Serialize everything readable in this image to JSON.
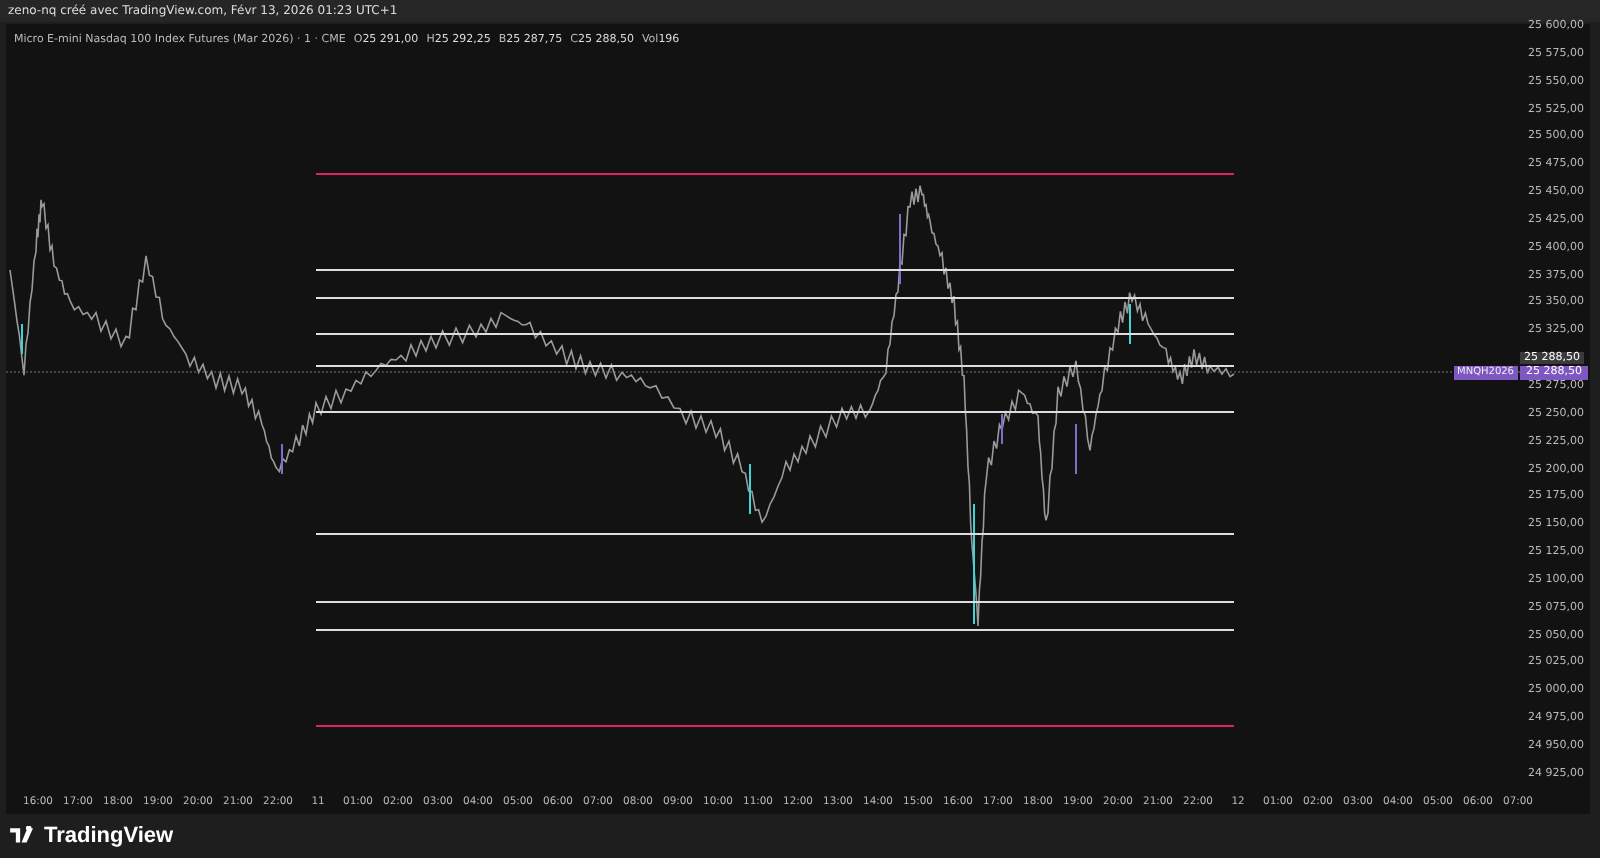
{
  "header": {
    "title": "zeno-nq créé avec TradingView.com, Févr 13, 2026 01:23 UTC+1"
  },
  "legend": {
    "symbol": "Micro E-mini Nasdaq 100 Index Futures (Mar 2026) · 1 · CME",
    "values": [
      {
        "key": "O",
        "value": "25 291,00"
      },
      {
        "key": "H",
        "value": "25 292,25"
      },
      {
        "key": "B",
        "value": "25 287,75"
      },
      {
        "key": "C",
        "value": "25 288,50"
      },
      {
        "key": "Vol",
        "value": "196"
      }
    ]
  },
  "price_axis": {
    "labels": [
      {
        "kind": "tick",
        "text": "25 600,00"
      },
      {
        "kind": "tick",
        "text": "25 575,00"
      },
      {
        "kind": "tick",
        "text": "25 550,00"
      },
      {
        "kind": "tick",
        "text": "25 525,00"
      },
      {
        "kind": "tick",
        "text": "25 500,00"
      },
      {
        "kind": "tick",
        "text": "25 475,00"
      },
      {
        "kind": "tick",
        "text": "25 450,00"
      },
      {
        "kind": "tick",
        "text": "25 425,00"
      },
      {
        "kind": "tick",
        "text": "25 400,00"
      },
      {
        "kind": "tick",
        "text": "25 375,00"
      },
      {
        "kind": "tick",
        "text": "25 350,00"
      },
      {
        "kind": "tick",
        "text": "25 325,00"
      },
      {
        "kind": "last",
        "text": "25 288,50"
      },
      {
        "kind": "tick",
        "text": "25 275,00"
      },
      {
        "kind": "tick",
        "text": "25 250,00"
      },
      {
        "kind": "tick",
        "text": "25 225,00"
      },
      {
        "kind": "tick",
        "text": "25 200,00"
      },
      {
        "kind": "tick",
        "text": "25 175,00"
      },
      {
        "kind": "tick",
        "text": "25 150,00"
      },
      {
        "kind": "tick",
        "text": "25 125,00"
      },
      {
        "kind": "tick",
        "text": "25 100,00"
      },
      {
        "kind": "tick",
        "text": "25 075,00"
      },
      {
        "kind": "tick",
        "text": "25 050,00"
      },
      {
        "kind": "tick",
        "text": "25 025,00"
      },
      {
        "kind": "tick",
        "text": "25 000,00"
      },
      {
        "kind": "tick",
        "text": "24 975,00"
      },
      {
        "kind": "tick",
        "text": "24 950,00"
      },
      {
        "kind": "tick",
        "text": "24 925,00"
      }
    ],
    "symbol_tag": "MNQH2026",
    "symbol_price": "25 288,50"
  },
  "time_axis": {
    "labels": [
      "16:00",
      "17:00",
      "18:00",
      "19:00",
      "20:00",
      "21:00",
      "22:00",
      "11",
      "01:00",
      "02:00",
      "03:00",
      "04:00",
      "05:00",
      "06:00",
      "07:00",
      "08:00",
      "09:00",
      "10:00",
      "11:00",
      "12:00",
      "13:00",
      "14:00",
      "15:00",
      "16:00",
      "17:00",
      "18:00",
      "19:00",
      "20:00",
      "21:00",
      "22:00",
      "12",
      "01:00",
      "02:00",
      "03:00",
      "04:00",
      "05:00",
      "06:00",
      "07:00"
    ]
  },
  "footer": {
    "brand": "TradingView"
  }
}
